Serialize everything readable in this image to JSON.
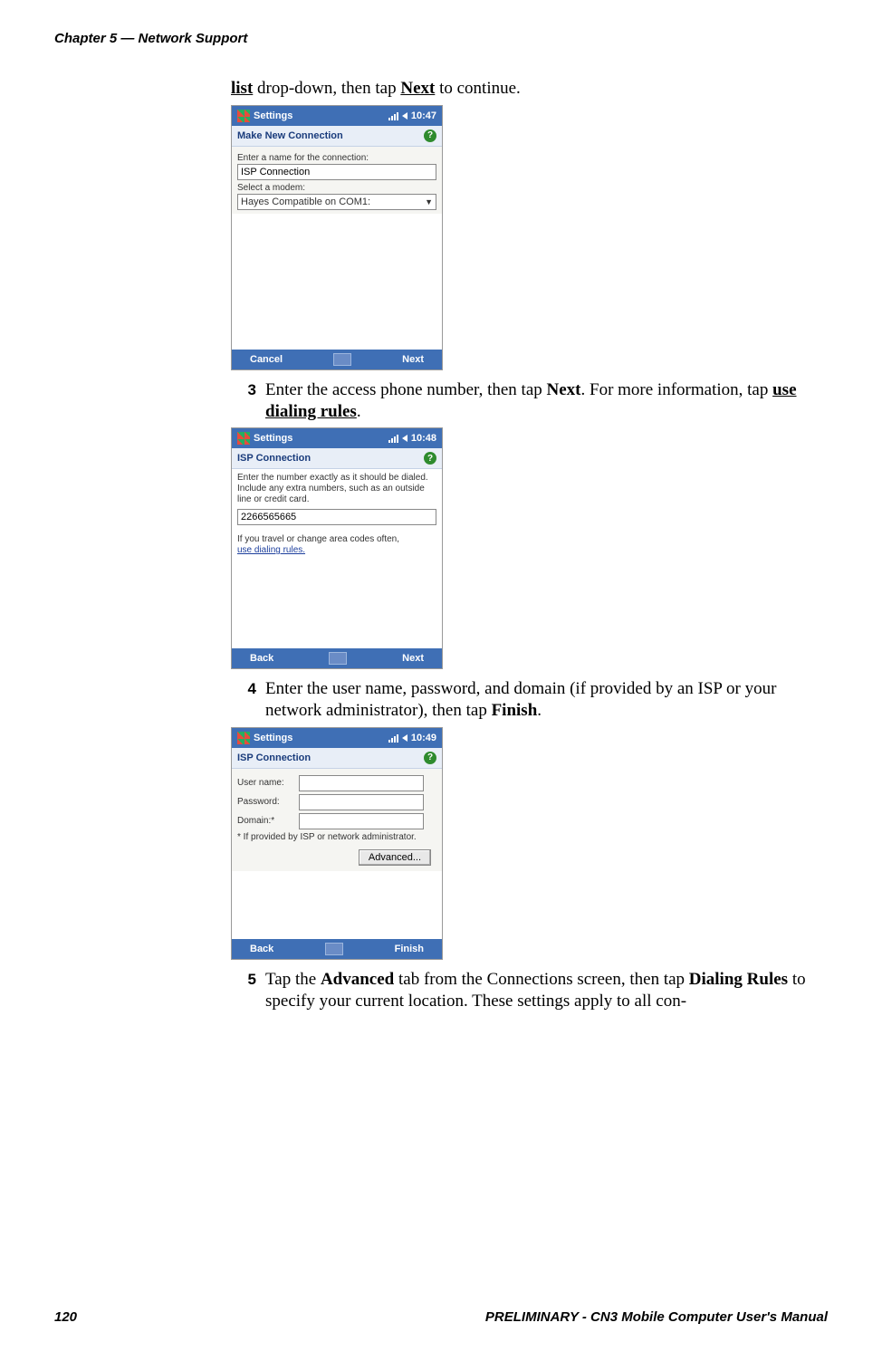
{
  "header": {
    "chapter": "Chapter 5 — Network Support"
  },
  "intro": {
    "list_text": "list",
    "middle1": " drop-down, then tap ",
    "next_text": "Next",
    "end1": " to continue."
  },
  "steps": {
    "s3": {
      "num": "3",
      "t1": "Enter the access phone number, then tap ",
      "next": "Next",
      "t2": ". For more information, tap ",
      "link": "use dialing rules",
      "t3": "."
    },
    "s4": {
      "num": "4",
      "t1": "Enter the user name, password, and domain (if provided by an ISP or your network administrator), then tap ",
      "finish": "Finish",
      "t2": "."
    },
    "s5": {
      "num": "5",
      "t1": "Tap the ",
      "adv": "Advanced",
      "t2": " tab from the Connections screen, then tap ",
      "dr": "Dialing Rules",
      "t3": " to specify your current location. These settings apply to all con-"
    }
  },
  "mock1": {
    "title": "Settings",
    "time": "10:47",
    "sub": "Make New Connection",
    "label1": "Enter a name for the connection:",
    "input1": "ISP Connection",
    "label2": "Select a modem:",
    "select1": "Hayes Compatible on COM1:",
    "left": "Cancel",
    "right": "Next"
  },
  "mock2": {
    "title": "Settings",
    "time": "10:48",
    "sub": "ISP Connection",
    "desc": "Enter the number exactly as it should be dialed.  Include any extra numbers, such as an outside line or credit card.",
    "phone": "2266565665",
    "hint1": "If you travel or change area codes often,",
    "link": "use dialing rules.",
    "left": "Back",
    "right": "Next"
  },
  "mock3": {
    "title": "Settings",
    "time": "10:49",
    "sub": "ISP Connection",
    "user": "User name:",
    "pass": "Password:",
    "domain": "Domain:*",
    "note": "* If provided by ISP or network administrator.",
    "adv": "Advanced...",
    "left": "Back",
    "right": "Finish"
  },
  "footer": {
    "page": "120",
    "title": "PRELIMINARY - CN3 Mobile Computer User's Manual"
  }
}
